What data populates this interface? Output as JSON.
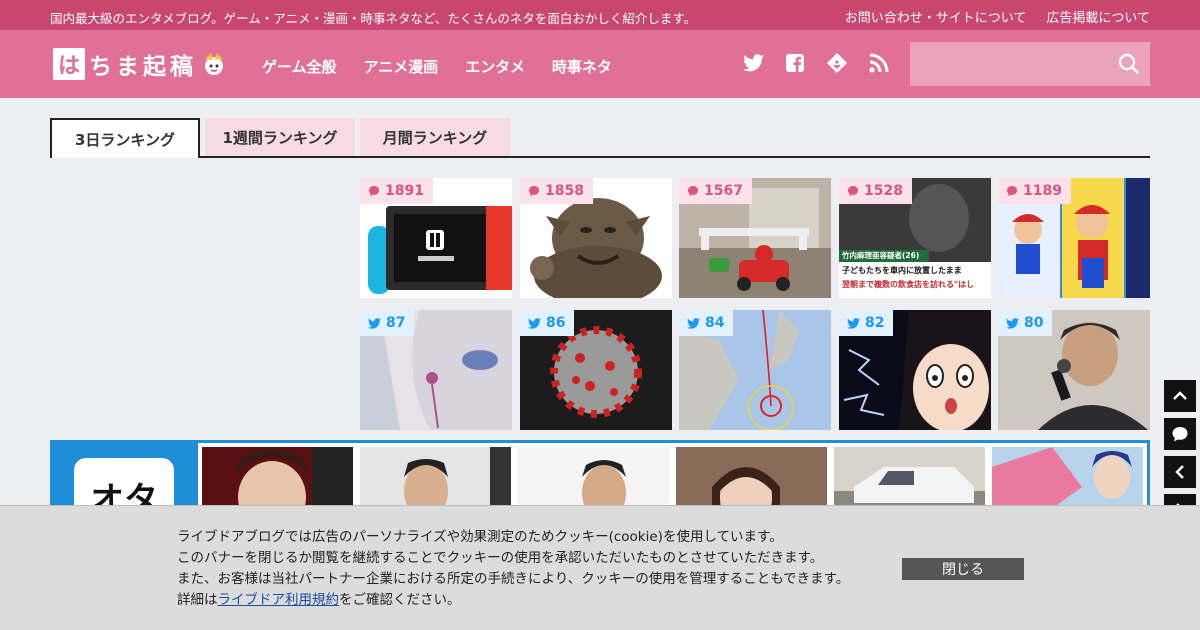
{
  "topbar": {
    "tagline": "国内最大級のエンタメブログ。ゲーム・アニメ・漫画・時事ネタなど、たくさんのネタを面白おかしく紹介します。",
    "contact_link": "お問い合わせ・サイトについて",
    "ad_link": "広告掲載について"
  },
  "header": {
    "logo_mark": "は",
    "logo_text": "ちま起稿",
    "nav": [
      "ゲーム全般",
      "アニメ漫画",
      "エンタメ",
      "時事ネタ"
    ],
    "social_icons": [
      "twitter-icon",
      "facebook-icon",
      "feedly-icon",
      "rss-icon"
    ],
    "search_placeholder": ""
  },
  "tabs": [
    "3日ランキング",
    "1週間ランキング",
    "月間ランキング"
  ],
  "ranking": {
    "comment_row": [
      {
        "count": "1891",
        "thumb": "nintendo-switch"
      },
      {
        "count": "1858",
        "thumb": "ogre-creature"
      },
      {
        "count": "1567",
        "thumb": "mario-kart-live"
      },
      {
        "count": "1528",
        "thumb": "news-caption"
      },
      {
        "count": "1189",
        "thumb": "super-mario"
      }
    ],
    "tweet_row": [
      {
        "count": "87",
        "thumb": "anime-earbuds"
      },
      {
        "count": "86",
        "thumb": "coronavirus"
      },
      {
        "count": "84",
        "thumb": "typhoon-map"
      },
      {
        "count": "82",
        "thumb": "anime-surprised"
      },
      {
        "count": "80",
        "thumb": "man-singing"
      }
    ],
    "news_caption_line1": "竹内麻理亜容疑者(26)",
    "news_caption_line2": "子どもたちを車内に放置したまま",
    "news_caption_line3": "翌朝まで複数の飲食店を訪れる\"はし"
  },
  "ota_banner": {
    "logo_text": "オタ"
  },
  "cookie": {
    "line1": "ライブドアブログでは広告のパーソナライズや効果測定のためクッキー(cookie)を使用しています。",
    "line2": "このバナーを閉じるか閲覧を継続することでクッキーの使用を承認いただいたものとさせていただきます。",
    "line3": "また、お客様は当社パートナー企業における所定の手続きにより、クッキーの使用を管理することもできます。",
    "line4_prefix": "詳細は",
    "line4_link": "ライブドア利用規約",
    "line4_suffix": "をご確認ください。",
    "close_label": "閉じる"
  },
  "colors": {
    "topbar": "#c8466f",
    "header": "#e07095",
    "comment_badge_text": "#d9567f",
    "tweet_badge_text": "#1d9bf0",
    "ota_blue": "#1e8fd8"
  }
}
